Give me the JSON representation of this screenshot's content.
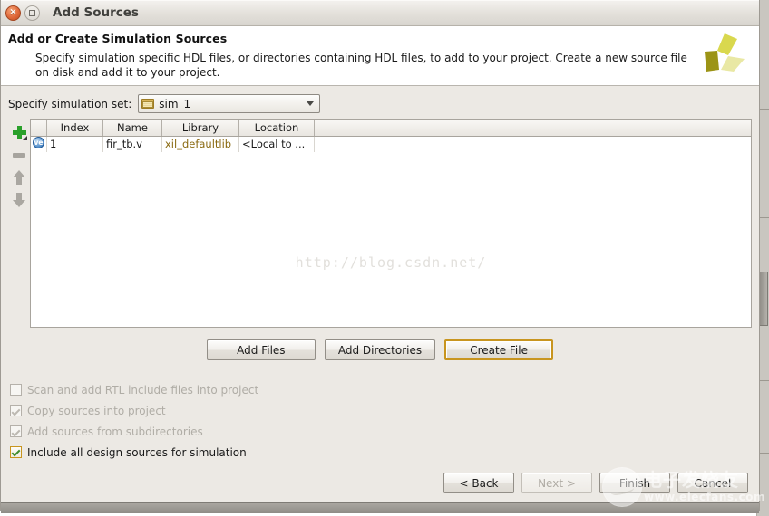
{
  "window": {
    "title": "Add Sources",
    "close_icon_glyph": "×",
    "maximize_icon": "maximize-icon"
  },
  "header": {
    "title": "Add or Create Simulation Sources",
    "description": "Specify simulation specific HDL files, or directories containing HDL files, to add to your project. Create a new source file on disk and add it to your project.",
    "logo_name": "xilinx-logo",
    "logo_colors": [
      "#d6d44a",
      "#9c9416",
      "#e8e79a"
    ]
  },
  "simulation_set": {
    "label": "Specify simulation set:",
    "value": "sim_1",
    "icon": "folder-icon",
    "dropdown_icon": "chevron-down-icon"
  },
  "side_tools": [
    {
      "name": "add-sources-button",
      "icon": "plus-icon",
      "enabled": true
    },
    {
      "name": "remove-sources-button",
      "icon": "minus-icon",
      "enabled": false
    },
    {
      "name": "move-up-button",
      "icon": "arrow-up-icon",
      "enabled": false
    },
    {
      "name": "move-down-button",
      "icon": "arrow-down-icon",
      "enabled": false
    }
  ],
  "table": {
    "columns": [
      "",
      "Index",
      "Name",
      "Library",
      "Location"
    ],
    "rows": [
      {
        "type_icon": "verilog-file-icon",
        "type_icon_label": "ve",
        "index": "1",
        "name": "fir_tb.v",
        "library": "xil_defaultlib",
        "location": "<Local to ..."
      }
    ]
  },
  "file_buttons": [
    {
      "label": "Add Files",
      "name": "add-files-button",
      "focused": false
    },
    {
      "label": "Add Directories",
      "name": "add-directories-button",
      "focused": false
    },
    {
      "label": "Create File",
      "name": "create-file-button",
      "focused": true
    }
  ],
  "options": [
    {
      "label": "Scan and add RTL include files into project",
      "name": "scan-rtl-include-checkbox",
      "checked": false,
      "enabled": false
    },
    {
      "label": "Copy sources into project",
      "name": "copy-sources-checkbox",
      "checked": true,
      "enabled": false
    },
    {
      "label": "Add sources from subdirectories",
      "name": "add-sources-subdirs-checkbox",
      "checked": true,
      "enabled": false
    },
    {
      "label": "Include all design sources for simulation",
      "name": "include-all-design-sources-checkbox",
      "checked": true,
      "enabled": true
    }
  ],
  "footer_buttons": [
    {
      "label": "< Back",
      "name": "back-button",
      "enabled": true
    },
    {
      "label": "Next >",
      "name": "next-button",
      "enabled": false
    },
    {
      "label": "Finish",
      "name": "finish-button",
      "enabled": true
    },
    {
      "label": "Cancel",
      "name": "cancel-button",
      "enabled": true
    }
  ],
  "watermarks": {
    "url": "http://blog.csdn.net/",
    "brand_cn": "电子发烧友",
    "brand_en": "www.elecfans.com"
  },
  "colors": {
    "dialog_background": "#ece9e4",
    "focus_border": "#c8951f",
    "accent_green": "#2aa02a",
    "library_text": "#8a6a12",
    "watermark_gray": "#e2e0dc"
  }
}
